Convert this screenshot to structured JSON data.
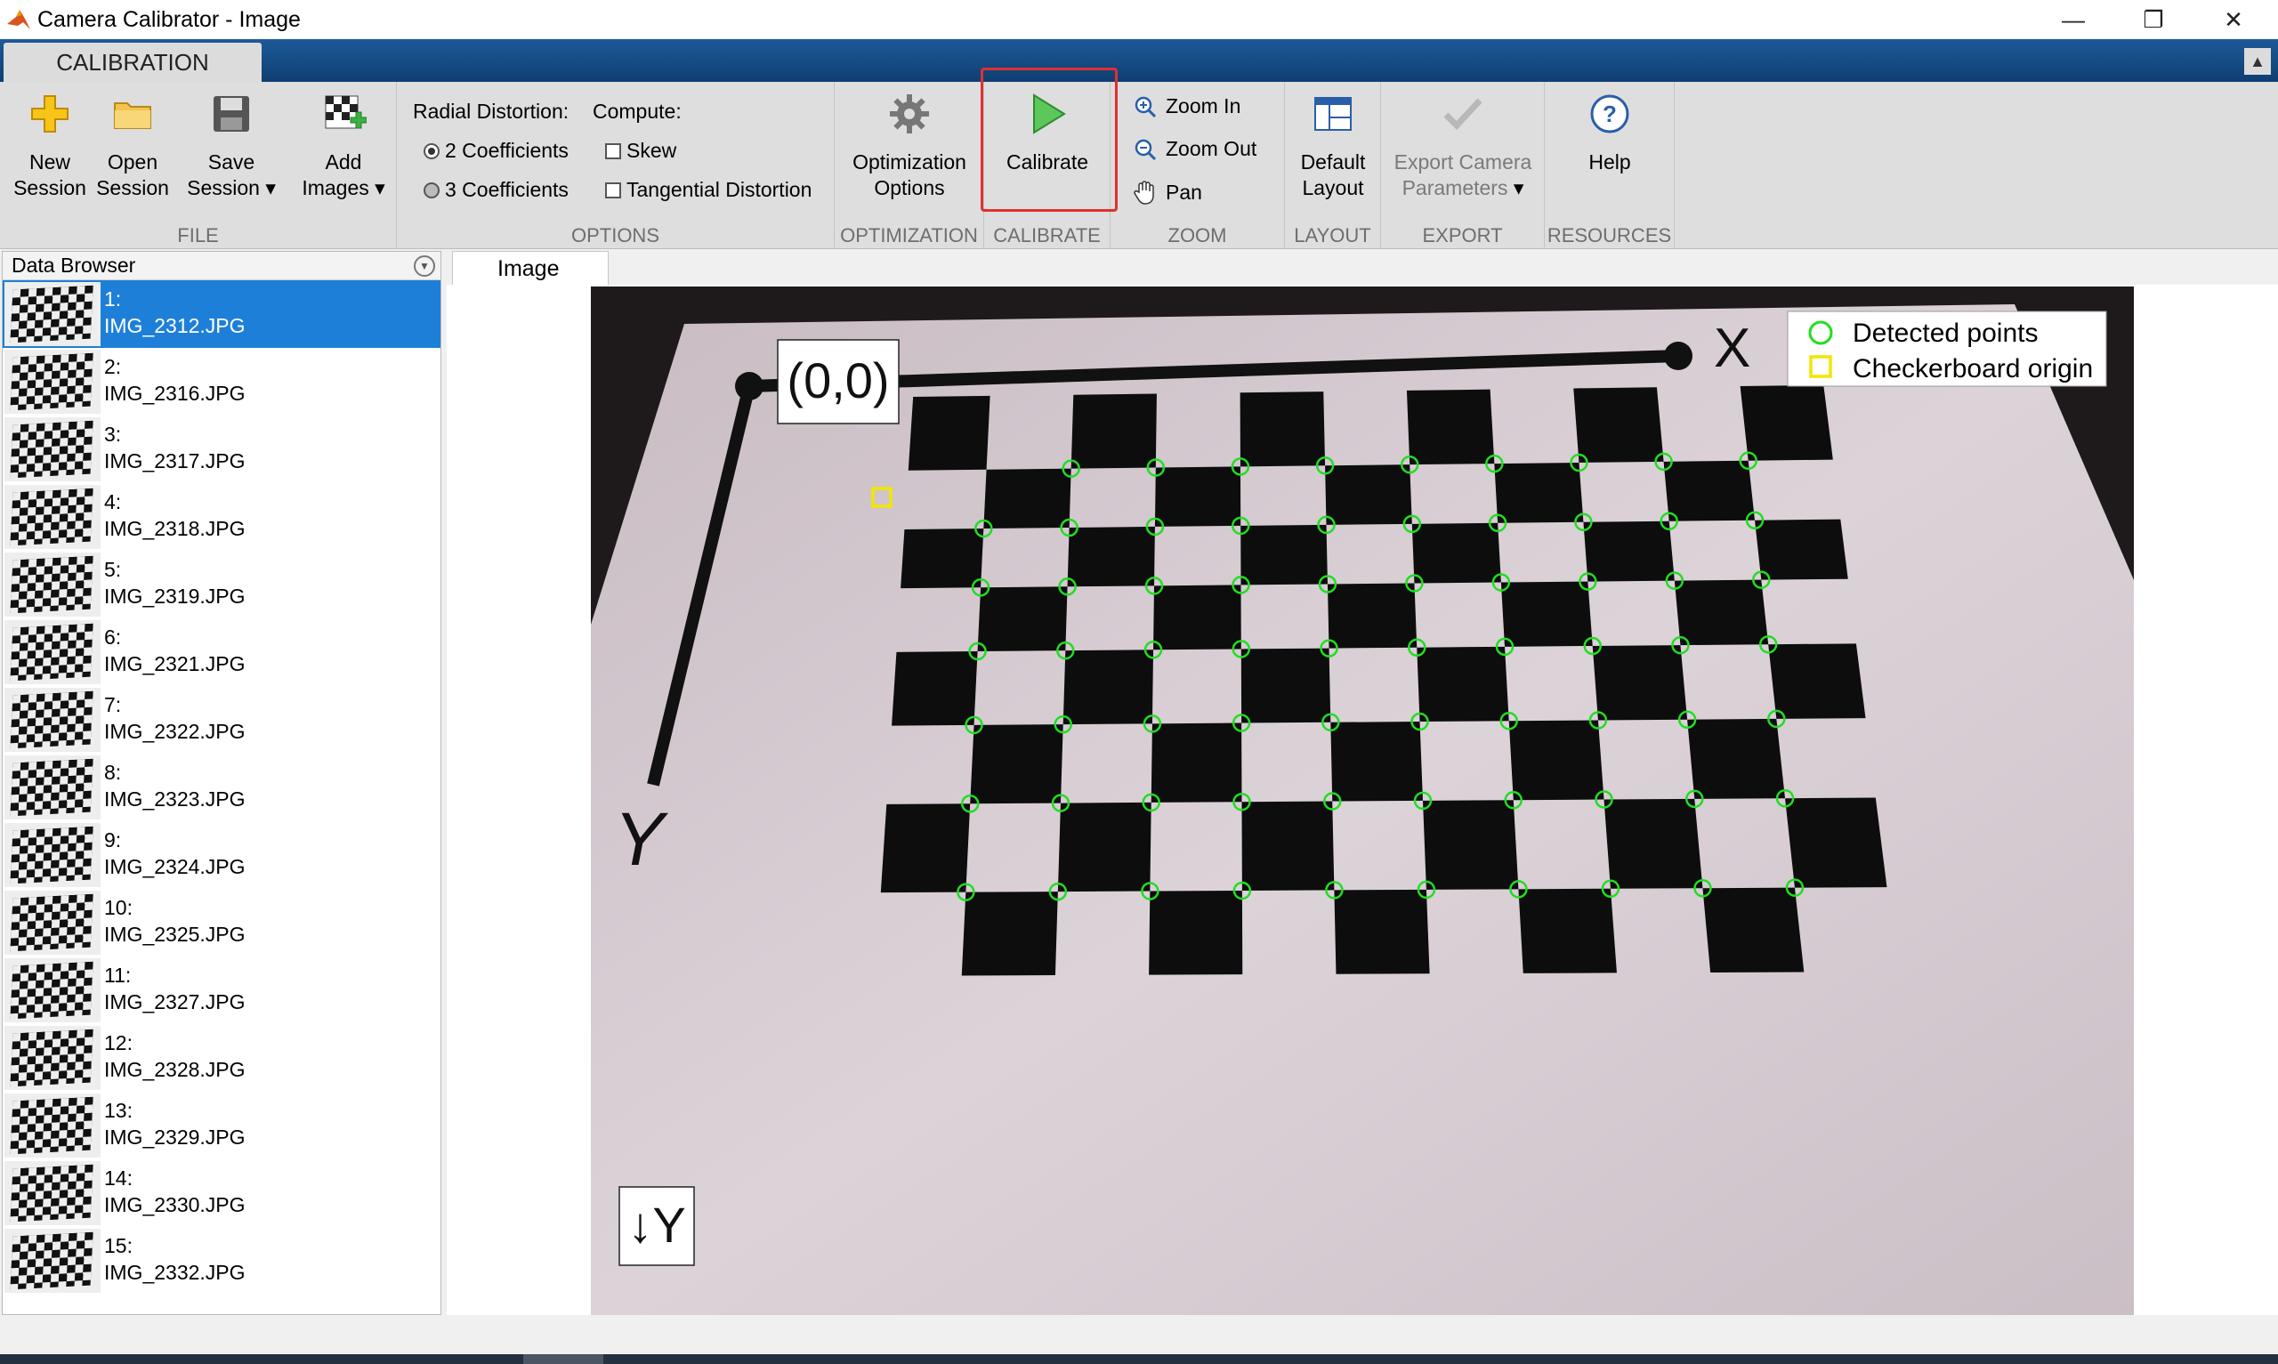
{
  "window": {
    "title": "Camera Calibrator - Image",
    "controls": {
      "minimize": "—",
      "restore": "❐",
      "close": "✕"
    }
  },
  "tabs": {
    "active": "CALIBRATION"
  },
  "ribbon": {
    "file": {
      "label": "FILE",
      "new_session": [
        "New",
        "Session"
      ],
      "open_session": [
        "Open",
        "Session"
      ],
      "save_session": [
        "Save",
        "Session"
      ],
      "add_images": [
        "Add",
        "Images"
      ]
    },
    "options": {
      "label": "OPTIONS",
      "radial_distortion_label": "Radial Distortion:",
      "radial_options": [
        "2 Coefficients",
        "3 Coefficients"
      ],
      "radial_selected": "2 Coefficients",
      "compute_label": "Compute:",
      "compute_options": [
        "Skew",
        "Tangential Distortion"
      ]
    },
    "optimization": {
      "label": "OPTIMIZATION",
      "button": [
        "Optimization",
        "Options"
      ]
    },
    "calibrate": {
      "label": "CALIBRATE",
      "button": "Calibrate"
    },
    "zoom": {
      "label": "ZOOM",
      "zoom_in": "Zoom In",
      "zoom_out": "Zoom Out",
      "pan": "Pan"
    },
    "layout": {
      "label": "LAYOUT",
      "button": [
        "Default",
        "Layout"
      ]
    },
    "export": {
      "label": "EXPORT",
      "button": [
        "Export Camera",
        "Parameters"
      ]
    },
    "resources": {
      "label": "RESOURCES",
      "button": "Help"
    }
  },
  "data_browser": {
    "title": "Data Browser",
    "selected_index": 0,
    "items": [
      {
        "num": "1:",
        "file": "IMG_2312.JPG"
      },
      {
        "num": "2:",
        "file": "IMG_2316.JPG"
      },
      {
        "num": "3:",
        "file": "IMG_2317.JPG"
      },
      {
        "num": "4:",
        "file": "IMG_2318.JPG"
      },
      {
        "num": "5:",
        "file": "IMG_2319.JPG"
      },
      {
        "num": "6:",
        "file": "IMG_2321.JPG"
      },
      {
        "num": "7:",
        "file": "IMG_2322.JPG"
      },
      {
        "num": "8:",
        "file": "IMG_2323.JPG"
      },
      {
        "num": "9:",
        "file": "IMG_2324.JPG"
      },
      {
        "num": "10:",
        "file": "IMG_2325.JPG"
      },
      {
        "num": "11:",
        "file": "IMG_2327.JPG"
      },
      {
        "num": "12:",
        "file": "IMG_2328.JPG"
      },
      {
        "num": "13:",
        "file": "IMG_2329.JPG"
      },
      {
        "num": "14:",
        "file": "IMG_2330.JPG"
      },
      {
        "num": "15:",
        "file": "IMG_2332.JPG"
      }
    ]
  },
  "image_view": {
    "tab": "Image",
    "legend": {
      "detected": "Detected points",
      "origin": "Checkerboard origin"
    },
    "labels": {
      "origin": "(0,0)",
      "x_axis": "X",
      "y_axis": "Y",
      "y_arrow": "↓Y"
    },
    "colors": {
      "detected": "#22dd22",
      "origin": "#f2e600"
    }
  }
}
